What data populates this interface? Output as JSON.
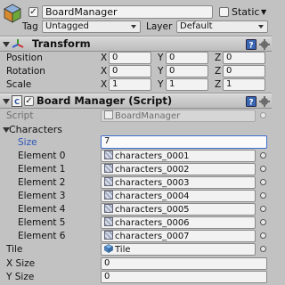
{
  "object": {
    "active_check": "✓",
    "name": "BoardManager",
    "static_label": "Static",
    "tag_label": "Tag",
    "tag_value": "Untagged",
    "layer_label": "Layer",
    "layer_value": "Default"
  },
  "transform": {
    "title": "Transform",
    "rows": [
      {
        "label": "Position",
        "x": "0",
        "y": "0",
        "z": "0"
      },
      {
        "label": "Rotation",
        "x": "0",
        "y": "0",
        "z": "0"
      },
      {
        "label": "Scale",
        "x": "1",
        "y": "1",
        "z": "1"
      }
    ],
    "axis_x": "X",
    "axis_y": "Y",
    "axis_z": "Z"
  },
  "board_manager": {
    "enabled_check": "✓",
    "title": "Board Manager (Script)",
    "script_label": "Script",
    "script_value": "BoardManager",
    "characters_label": "Characters",
    "size_label": "Size",
    "size_value": "7",
    "elements": [
      {
        "label": "Element 0",
        "value": "characters_0001"
      },
      {
        "label": "Element 1",
        "value": "characters_0002"
      },
      {
        "label": "Element 2",
        "value": "characters_0003"
      },
      {
        "label": "Element 3",
        "value": "characters_0004"
      },
      {
        "label": "Element 4",
        "value": "characters_0005"
      },
      {
        "label": "Element 5",
        "value": "characters_0006"
      },
      {
        "label": "Element 6",
        "value": "characters_0007"
      }
    ],
    "tile_label": "Tile",
    "tile_value": "Tile",
    "xsize_label": "X Size",
    "xsize_value": "0",
    "ysize_label": "Y Size",
    "ysize_value": "0"
  },
  "icons": {
    "gameobject": "cube-icon",
    "transform": "transform-axes-icon",
    "script": "script-icon",
    "help": "help-book-icon",
    "settings": "gear-icon",
    "object_field": "sprite-icon",
    "picker": "object-picker-icon"
  },
  "colors": {
    "panel_bg": "#c2c2c2",
    "field_bg": "#f2f2f2",
    "focus_border": "#3d6fd1",
    "help_icon": "#3a67b4"
  }
}
